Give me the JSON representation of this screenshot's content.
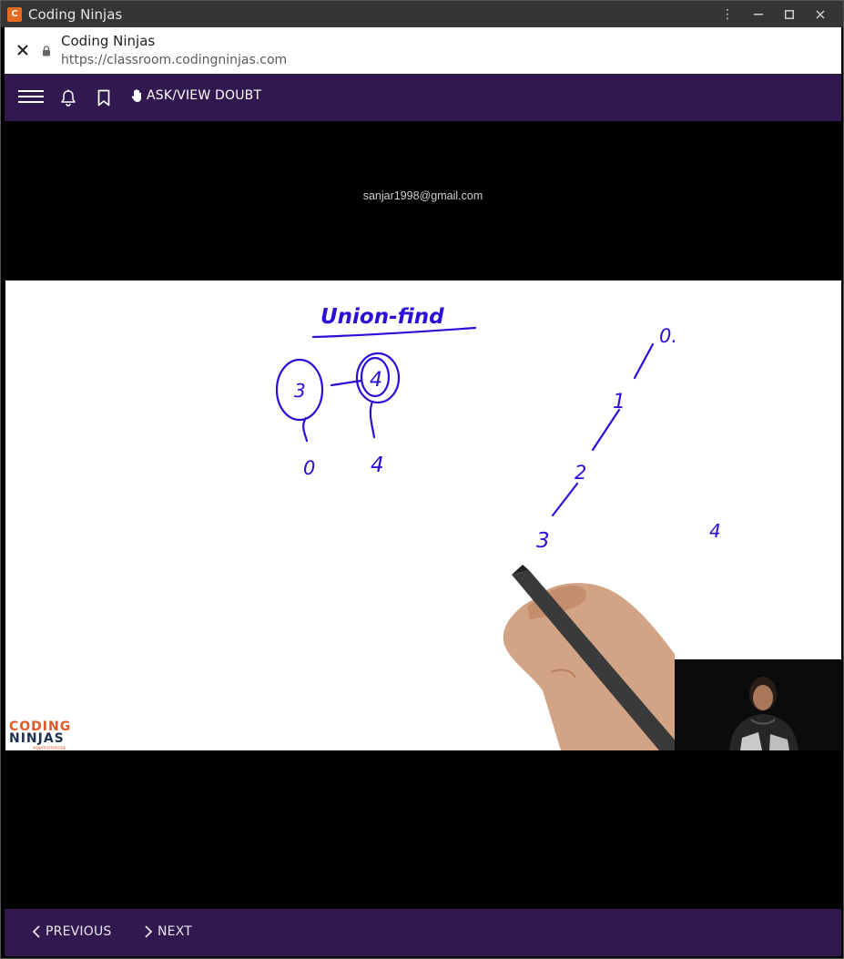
{
  "window": {
    "title": "Coding Ninjas",
    "app_icon_letter": "C",
    "controls": {
      "menu": "⋮",
      "minimize": "—",
      "maximize": "□",
      "close": "✕"
    }
  },
  "urlbar": {
    "close_label": "✕",
    "site_title": "Coding Ninjas",
    "url": "https://classroom.codingninjas.com"
  },
  "toolbar": {
    "doubt_label": "ASK/VIEW DOUBT",
    "accent": "#31194f"
  },
  "video": {
    "watermark": "sanjar1998@gmail.com",
    "brand_line1": "CODING",
    "brand_line2": "NINJAS",
    "brand_tag": "#SWITCHTOCODE",
    "board_title": "Union-find",
    "board_labels": [
      "3",
      "4",
      "0",
      "4",
      "0.",
      "1",
      "2",
      "3",
      "4"
    ],
    "ink_color": "#2a0fd6"
  },
  "nav": {
    "previous_label": "PREVIOUS",
    "next_label": "NEXT"
  }
}
